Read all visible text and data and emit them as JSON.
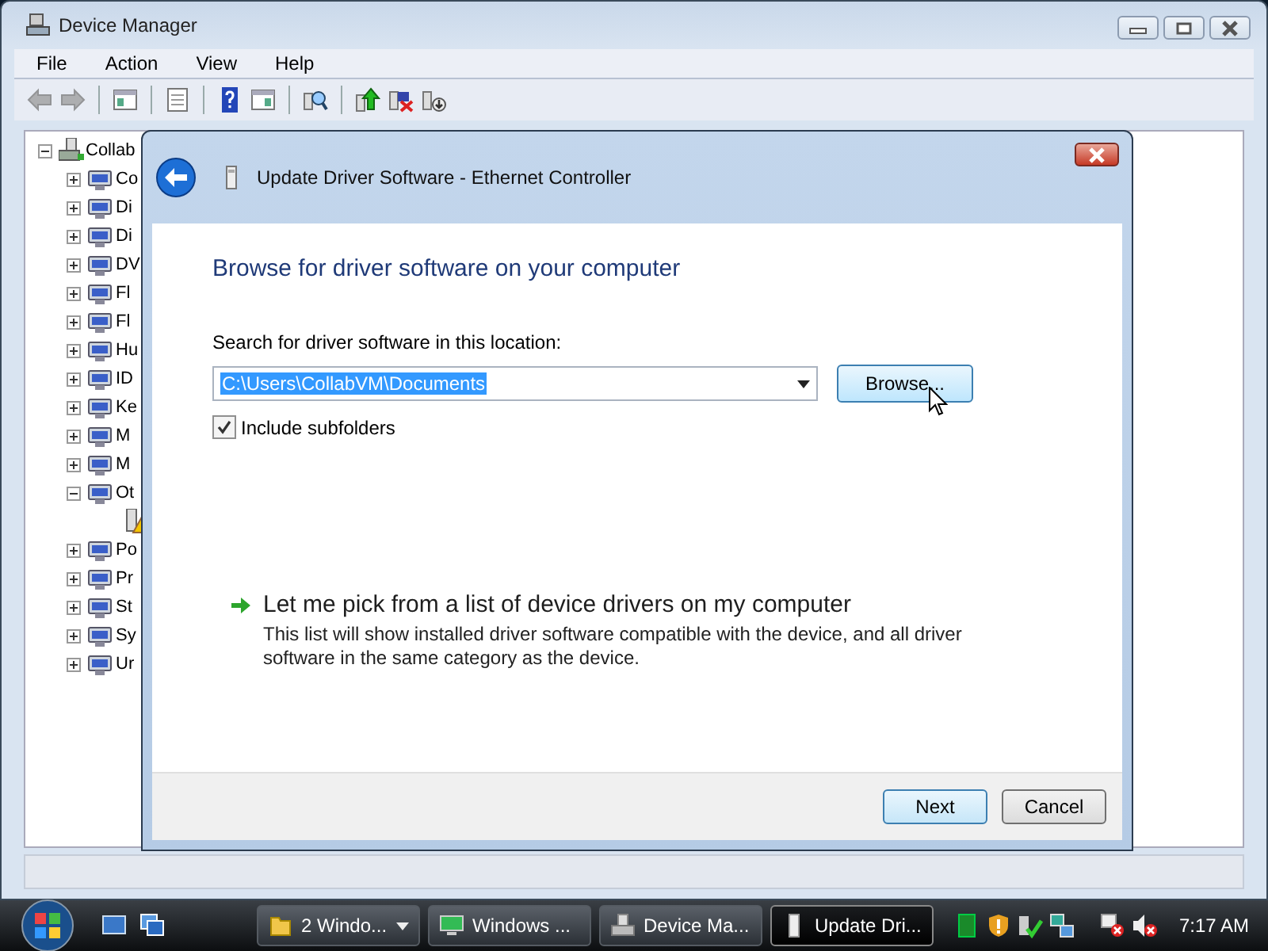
{
  "device_manager": {
    "title": "Device Manager",
    "menu": [
      "File",
      "Action",
      "View",
      "Help"
    ],
    "toolbar": [
      {
        "kind": "back",
        "disabled": true
      },
      {
        "kind": "forward",
        "disabled": true
      },
      {
        "kind": "separator"
      },
      {
        "kind": "console-tree",
        "disabled": false
      },
      {
        "kind": "separator"
      },
      {
        "kind": "properties",
        "disabled": false
      },
      {
        "kind": "separator"
      },
      {
        "kind": "help",
        "disabled": false
      },
      {
        "kind": "action-pane",
        "disabled": false
      },
      {
        "kind": "separator"
      },
      {
        "kind": "scan",
        "disabled": false
      },
      {
        "kind": "separator"
      },
      {
        "kind": "update-driver",
        "disabled": false
      },
      {
        "kind": "uninstall",
        "disabled": false
      },
      {
        "kind": "disable",
        "disabled": false
      }
    ],
    "tree": {
      "label": "Collab",
      "expanded": true,
      "children": [
        {
          "label": "Co",
          "expanded": false
        },
        {
          "label": "Di",
          "expanded": false
        },
        {
          "label": "Di",
          "expanded": false
        },
        {
          "label": "DV",
          "expanded": false
        },
        {
          "label": "Fl",
          "expanded": false
        },
        {
          "label": "Fl",
          "expanded": false
        },
        {
          "label": "Hu",
          "expanded": false
        },
        {
          "label": "ID",
          "expanded": false
        },
        {
          "label": "Ke",
          "expanded": false
        },
        {
          "label": "M",
          "expanded": false
        },
        {
          "label": "M",
          "expanded": false
        },
        {
          "label": "Ot",
          "expanded": true,
          "children": [
            {
              "kind": "warning-device"
            }
          ]
        },
        {
          "label": "Po",
          "expanded": false
        },
        {
          "label": "Pr",
          "expanded": false
        },
        {
          "label": "St",
          "expanded": false
        },
        {
          "label": "Sy",
          "expanded": false
        },
        {
          "label": "Ur",
          "expanded": false
        }
      ]
    }
  },
  "dialog": {
    "title": "Update Driver Software - Ethernet Controller",
    "heading": "Browse for driver software on your computer",
    "location_label": "Search for driver software in this location:",
    "location": {
      "value": "C:\\Users\\CollabVM\\Documents",
      "selected": true
    },
    "browse_button": "Browse...",
    "include_subfolders": {
      "label": "Include subfolders",
      "checked": true
    },
    "pick_option": {
      "title": "Let me pick from a list of device drivers on my computer",
      "description": "This list will show installed driver software compatible with the device, and all driver software in the same category as the device."
    },
    "buttons": [
      {
        "label": "Next",
        "default": true
      },
      {
        "label": "Cancel",
        "default": false
      }
    ]
  },
  "taskbar": {
    "tasks": [
      {
        "label": "2 Windo...",
        "kind": "folder",
        "selected": false,
        "grouped": true
      },
      {
        "label": "Windows ...",
        "kind": "monitor",
        "selected": false,
        "grouped": false
      },
      {
        "label": "Device Ma...",
        "kind": "device",
        "selected": false,
        "grouped": false
      },
      {
        "label": "Update Dri...",
        "kind": "driver",
        "selected": true,
        "grouped": false
      }
    ],
    "clock": "7:17 AM"
  }
}
